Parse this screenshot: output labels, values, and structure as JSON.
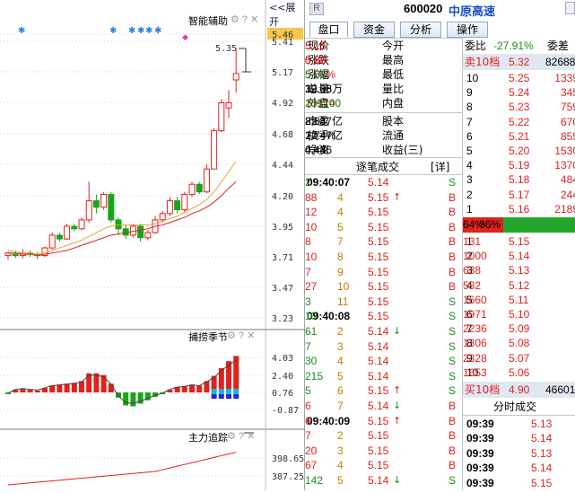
{
  "chart": {
    "top_label": "智能辅助",
    "expand_label": "<<展开",
    "collapse_icon": "«",
    "price_axis": [
      "5.46",
      "5.41",
      "5.17",
      "4.92",
      "4.68",
      "4.44",
      "4.20",
      "3.95",
      "3.71",
      "3.47",
      "3.23"
    ],
    "peak_note": "5.35",
    "mid_label": "捕捞季节",
    "mid_axis": [
      "4.03",
      "2.40",
      "0.76",
      "-0.87"
    ],
    "bot_label": "主力追踪",
    "bot_axis": [
      "398.65",
      "387.25"
    ],
    "colors": {
      "up": "#e0211d",
      "down": "#18a51a",
      "ma1": "#e6a23c",
      "ma2": "#e0211d"
    }
  },
  "header": {
    "badge": "R",
    "code": "600020",
    "name": "中原高速"
  },
  "tabs": [
    "盘口",
    "资金",
    "分析",
    "操作"
  ],
  "quote": [
    {
      "k1": "现价",
      "v1": "5.13",
      "k2": "今开",
      "v2": "5.15"
    },
    {
      "k1": "涨跌",
      "v1": "0.27",
      "k2": "最高",
      "v2": "5.35"
    },
    {
      "k1": "涨幅",
      "v1": "5.56%",
      "k2": "最低",
      "v2": "5.08"
    },
    {
      "k1": "总量",
      "v1": "39.08万",
      "k2": "量比",
      "v2": "12.36"
    },
    {
      "k1": "外盘",
      "v1": "151700",
      "k2": "内盘",
      "v2": "239140"
    }
  ],
  "quote2": [
    {
      "k1": "市盈",
      "v1": "8.83",
      "k2": "股本",
      "v2": "22.47亿"
    },
    {
      "k1": "换手",
      "v1": "1.74%",
      "k2": "流通",
      "v2": "22.47亿"
    },
    {
      "k1": "净资",
      "v1": "4.44",
      "k2": "收益(三)",
      "v2": "0.436"
    }
  ],
  "ticks_header": {
    "title": "逐笔成交",
    "detail": "[详]"
  },
  "ticks": [
    {
      "t": "09:40:07",
      "p": "5.14",
      "a": "",
      "v": "2",
      "f": "S"
    },
    {
      "t": "4",
      "p": "5.15",
      "a": "↑",
      "v": "88",
      "f": "B"
    },
    {
      "t": "4",
      "p": "5.15",
      "a": "",
      "v": "12",
      "f": "B"
    },
    {
      "t": "5",
      "p": "5.15",
      "a": "",
      "v": "10",
      "f": "B"
    },
    {
      "t": "7",
      "p": "5.15",
      "a": "",
      "v": "8",
      "f": "B"
    },
    {
      "t": "8",
      "p": "5.15",
      "a": "",
      "v": "10",
      "f": "B"
    },
    {
      "t": "9",
      "p": "5.15",
      "a": "",
      "v": "7",
      "f": "B"
    },
    {
      "t": "10",
      "p": "5.15",
      "a": "",
      "v": "27",
      "f": "B"
    },
    {
      "t": "11",
      "p": "5.15",
      "a": "",
      "v": "3",
      "f": "S"
    },
    {
      "t": "09:40:08",
      "p": "5.15",
      "a": "",
      "v": "10",
      "f": "S"
    },
    {
      "t": "2",
      "p": "5.14",
      "a": "↓",
      "v": "61",
      "f": "S"
    },
    {
      "t": "3",
      "p": "5.14",
      "a": "",
      "v": "7",
      "f": "S"
    },
    {
      "t": "4",
      "p": "5.14",
      "a": "",
      "v": "30",
      "f": "S"
    },
    {
      "t": "5",
      "p": "5.14",
      "a": "",
      "v": "215",
      "f": "S"
    },
    {
      "t": "6",
      "p": "5.15",
      "a": "↑",
      "v": "5",
      "f": "S"
    },
    {
      "t": "7",
      "p": "5.14",
      "a": "↓",
      "v": "6",
      "f": "B"
    },
    {
      "t": "09:40:09",
      "p": "5.15",
      "a": "↑",
      "v": "6",
      "f": "B"
    },
    {
      "t": "2",
      "p": "5.15",
      "a": "",
      "v": "7",
      "f": "B"
    },
    {
      "t": "3",
      "p": "5.15",
      "a": "",
      "v": "20",
      "f": "B"
    },
    {
      "t": "4",
      "p": "5.15",
      "a": "",
      "v": "67",
      "f": "B"
    },
    {
      "t": "5",
      "p": "5.14",
      "a": "↓",
      "v": "142",
      "f": "S"
    }
  ],
  "book": {
    "weibi_label": "委比",
    "weibi": "-27.91%",
    "weicha_label": "委差",
    "sell10_label": "卖10档",
    "sell10_price": "5.32",
    "sell10_vol": "82688",
    "sells": [
      {
        "n": "10",
        "p": "5.25",
        "v": "1339"
      },
      {
        "n": "9",
        "p": "5.24",
        "v": "345"
      },
      {
        "n": "8",
        "p": "5.23",
        "v": "759"
      },
      {
        "n": "7",
        "p": "5.22",
        "v": "670"
      },
      {
        "n": "6",
        "p": "5.21",
        "v": "855"
      },
      {
        "n": "5",
        "p": "5.20",
        "v": "1530"
      },
      {
        "n": "4",
        "p": "5.19",
        "v": "1370"
      },
      {
        "n": "3",
        "p": "5.18",
        "v": "484"
      },
      {
        "n": "2",
        "p": "5.17",
        "v": "244"
      },
      {
        "n": "1",
        "p": "5.16",
        "v": "2189"
      }
    ],
    "ratio_left": "36%",
    "ratio_right": "64%",
    "ratio_value": 0.36,
    "buys": [
      {
        "n": "1",
        "p": "5.15",
        "v": "131"
      },
      {
        "n": "2",
        "p": "5.14",
        "v": "1000"
      },
      {
        "n": "3",
        "p": "5.13",
        "v": "638"
      },
      {
        "n": "4",
        "p": "5.12",
        "v": "582"
      },
      {
        "n": "5",
        "p": "5.11",
        "v": "1660"
      },
      {
        "n": "6",
        "p": "5.10",
        "v": "1971"
      },
      {
        "n": "7",
        "p": "5.09",
        "v": "2236"
      },
      {
        "n": "8",
        "p": "5.08",
        "v": "1306"
      },
      {
        "n": "9",
        "p": "5.07",
        "v": "2328"
      },
      {
        "n": "10",
        "p": "5.06",
        "v": "1653"
      }
    ],
    "buy10_label": "买10档",
    "buy10_price": "4.90",
    "buy10_vol": "46601"
  },
  "timeshare": {
    "title": "分时成交",
    "rows": [
      {
        "t": "09:39",
        "p": "5.13"
      },
      {
        "t": "09:39",
        "p": "5.14"
      },
      {
        "t": "09:39",
        "p": "5.13"
      },
      {
        "t": "09:39",
        "p": "5.14"
      },
      {
        "t": "09:39",
        "p": "5.15"
      }
    ]
  }
}
